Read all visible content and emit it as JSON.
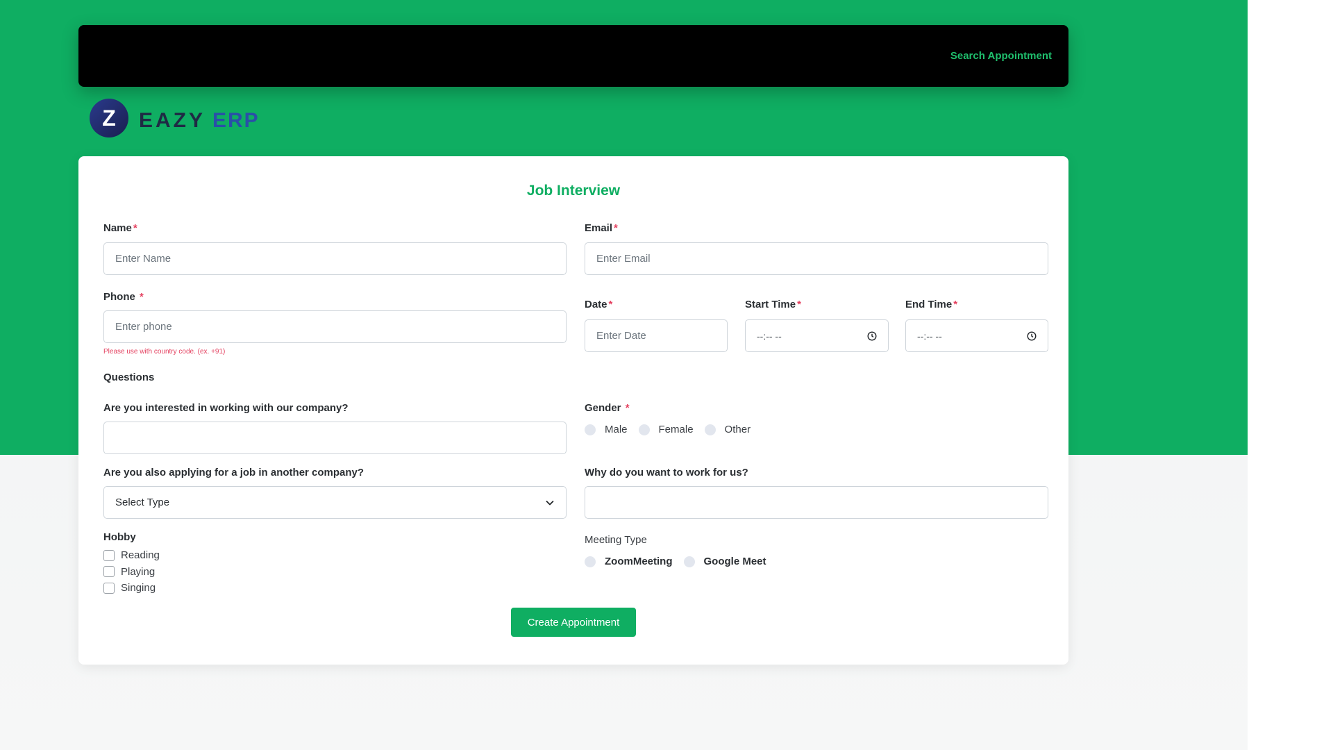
{
  "navbar": {
    "search_link": "Search Appointment"
  },
  "logo": {
    "mark": "Z",
    "word_part1": "EAZY",
    "word_part2": "ERP"
  },
  "form": {
    "title": "Job Interview",
    "name_label": "Name",
    "name_placeholder": "Enter Name",
    "email_label": "Email",
    "email_placeholder": "Enter Email",
    "phone_label": "Phone ",
    "phone_placeholder": "Enter phone",
    "phone_hint": "Please use with country code. (ex. +91)",
    "date_label": "Date",
    "date_placeholder": "Enter Date",
    "start_time_label": "Start Time",
    "start_time_value": "--:-- --",
    "end_time_label": "End Time",
    "end_time_value": "--:-- --",
    "required_mark": "*",
    "questions_title": "Questions",
    "q_interested_label": "Are you interested in working with our company?",
    "gender_label": "Gender ",
    "gender_options": [
      "Male",
      "Female",
      "Other"
    ],
    "q_other_company_label": "Are you also applying for a job in another company?",
    "select_type_value": "Select Type",
    "q_why_label": "Why do you want to work for us?",
    "hobby_label": "Hobby",
    "hobbies": [
      "Reading",
      "Playing",
      "Singing"
    ],
    "meeting_type_label": "Meeting Type",
    "meeting_options": [
      "ZoomMeeting",
      "Google Meet"
    ],
    "submit_label": "Create Appointment"
  },
  "colors": {
    "brand_green": "#0fae62",
    "navbar_bg": "#000000",
    "required_red": "#e4405f"
  }
}
